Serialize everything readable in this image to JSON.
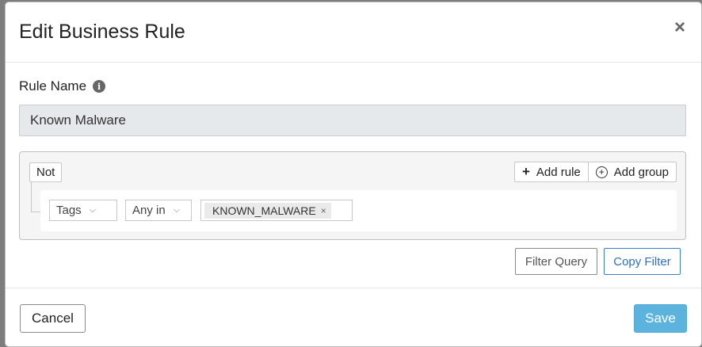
{
  "dialog": {
    "title": "Edit Business Rule",
    "close_glyph": "×"
  },
  "rule_name": {
    "label": "Rule Name",
    "info_glyph": "i",
    "value": "Known Malware"
  },
  "query_builder": {
    "not_label": "Not",
    "add_rule_glyph": "+",
    "add_rule_label": "Add rule",
    "add_group_glyph": "+",
    "add_group_label": "Add group",
    "rule": {
      "field": "Tags",
      "operator": "Any in",
      "chevron_glyph": "⌵",
      "tag_value": "KNOWN_MALWARE",
      "tag_remove_glyph": "×"
    }
  },
  "actions": {
    "filter_query_label": "Filter Query",
    "copy_filter_label": "Copy Filter",
    "cancel_label": "Cancel",
    "save_label": "Save"
  },
  "colors": {
    "save_button": "#5bb3de",
    "copy_filter_accent": "#2d70c0",
    "input_background": "#e6e9eb"
  }
}
